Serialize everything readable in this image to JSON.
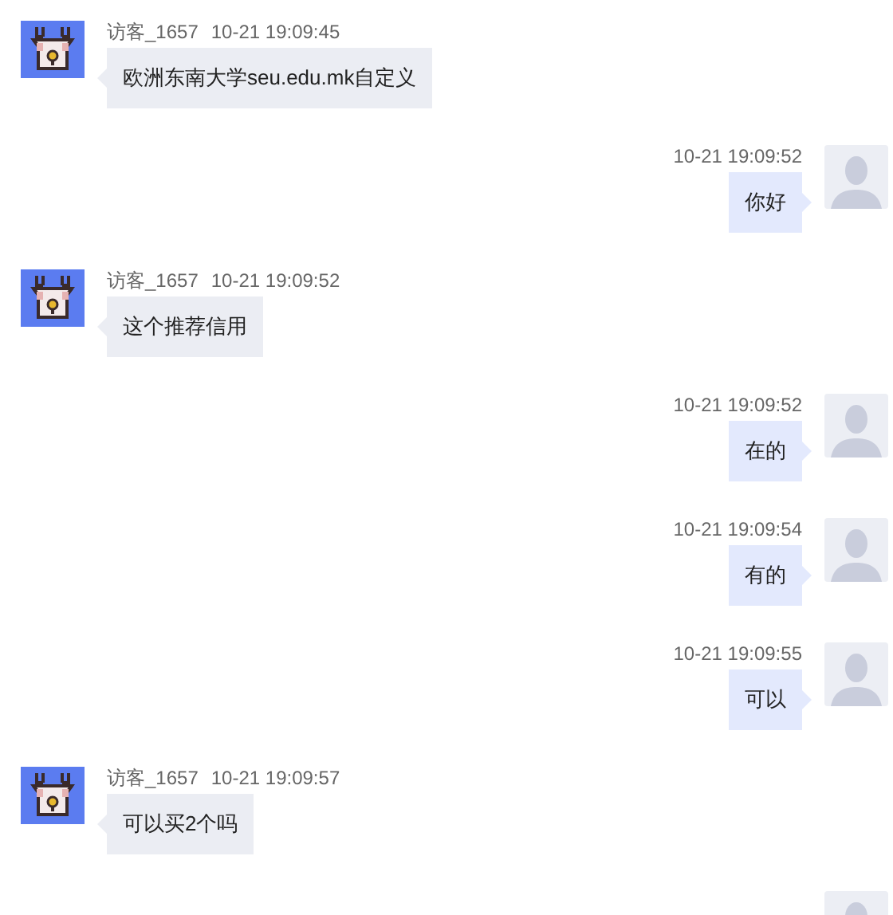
{
  "messages": [
    {
      "kind": "visitor",
      "name": "访客_1657",
      "time": "10-21 19:09:45",
      "text": "欧洲东南大学seu.edu.mk自定义"
    },
    {
      "kind": "agent",
      "time": "10-21 19:09:52",
      "text": "你好"
    },
    {
      "kind": "visitor",
      "name": "访客_1657",
      "time": "10-21 19:09:52",
      "text": "这个推荐信用"
    },
    {
      "kind": "agent",
      "time": "10-21 19:09:52",
      "text": "在的"
    },
    {
      "kind": "agent",
      "time": "10-21 19:09:54",
      "text": "有的"
    },
    {
      "kind": "agent",
      "time": "10-21 19:09:55",
      "text": "可以"
    },
    {
      "kind": "visitor",
      "name": "访客_1657",
      "time": "10-21 19:09:57",
      "text": "可以买2个吗"
    },
    {
      "kind": "agent"
    }
  ]
}
